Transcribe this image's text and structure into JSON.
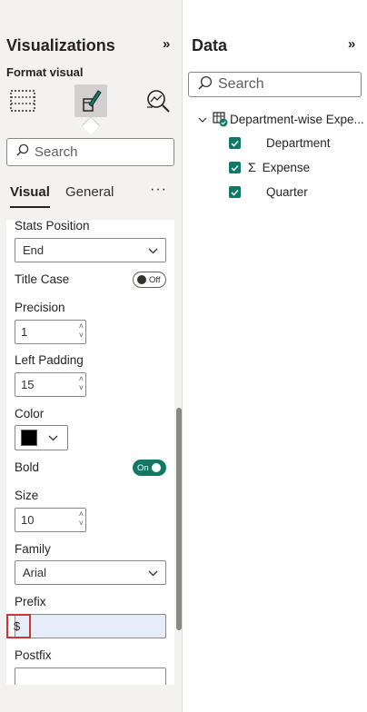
{
  "visualizations": {
    "title": "Visualizations",
    "collapse_glyph": "»",
    "format_label": "Format visual",
    "icons": [
      "build-visual-icon",
      "format-visual-icon",
      "analytics-icon"
    ],
    "search_placeholder": "Search",
    "tabs": {
      "visual": "Visual",
      "general": "General",
      "more": "···"
    },
    "settings": {
      "stats_position": {
        "label": "Stats Position",
        "value": "End"
      },
      "title_case": {
        "label": "Title Case",
        "toggle": "Off"
      },
      "precision": {
        "label": "Precision",
        "value": "1"
      },
      "left_padding": {
        "label": "Left Padding",
        "value": "15"
      },
      "color": {
        "label": "Color",
        "swatch": "#000000"
      },
      "bold": {
        "label": "Bold",
        "toggle": "On"
      },
      "size": {
        "label": "Size",
        "value": "10"
      },
      "family": {
        "label": "Family",
        "value": "Arial"
      },
      "prefix": {
        "label": "Prefix",
        "value": "$"
      },
      "postfix": {
        "label": "Postfix",
        "value": ""
      }
    }
  },
  "data_pane": {
    "title": "Data",
    "collapse_glyph": "»",
    "search_placeholder": "Search",
    "table": {
      "name": "Department-wise Expe...",
      "fields": [
        {
          "name": "Department",
          "checked": true,
          "sigma": false
        },
        {
          "name": "Expense",
          "checked": true,
          "sigma": true
        },
        {
          "name": "Quarter",
          "checked": true,
          "sigma": false
        }
      ]
    }
  },
  "colors": {
    "accent_green": "#117865",
    "highlight_red": "#d13438",
    "prefix_fill": "#e5edfa"
  }
}
